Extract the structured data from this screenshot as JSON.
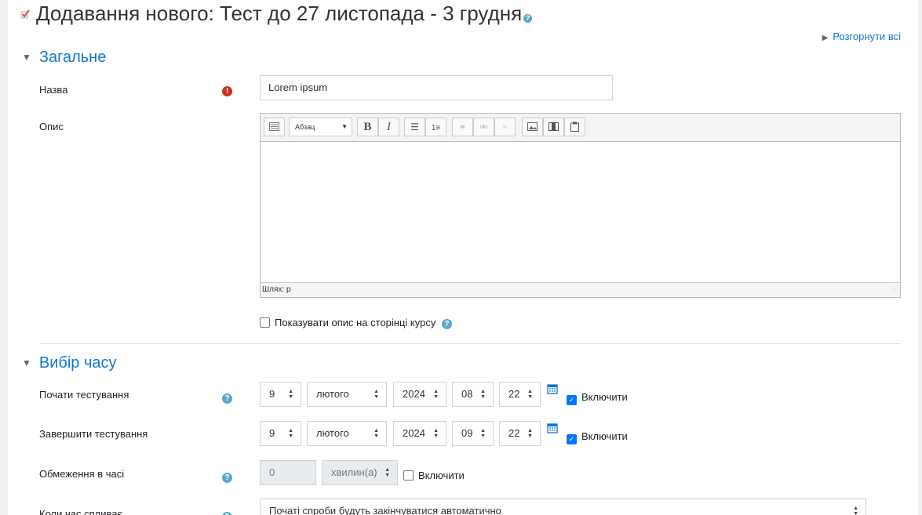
{
  "header": {
    "title": "Додавання нового: Тест до 27 листопада - 3 грудня",
    "expand_all": "Розгорнути всі"
  },
  "general": {
    "heading": "Загальне",
    "name_label": "Назва",
    "name_value": "Lorem ipsum",
    "desc_label": "Опис",
    "toolbar_format": "Абзац",
    "bold": "B",
    "italic": "I",
    "status_path": "Шлях: p",
    "show_desc": "Показувати опис на сторінці курсу"
  },
  "timing": {
    "heading": "Вибір часу",
    "open_label": "Почати тестування",
    "open": {
      "day": "9",
      "month": "лютого",
      "year": "2024",
      "hour": "08",
      "minute": "22",
      "enable": "Включити"
    },
    "close_label": "Завершити тестування",
    "close": {
      "day": "9",
      "month": "лютого",
      "year": "2024",
      "hour": "09",
      "minute": "22",
      "enable": "Включити"
    },
    "limit_label": "Обмеження в часі",
    "limit_value": "0",
    "limit_unit": "хвилин(а)",
    "limit_enable": "Включити",
    "expire_label": "Коли час спливає",
    "expire_value": "Початі спроби будуть закінчуватися автоматично"
  },
  "colors": {
    "link": "#1177d1",
    "required": "#ca3120",
    "help": "#5ba7c9"
  }
}
